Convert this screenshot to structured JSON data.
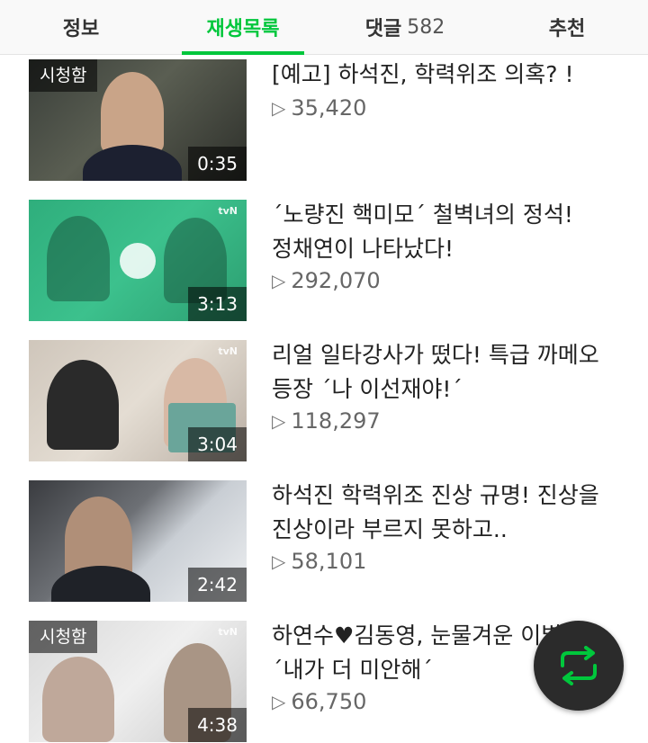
{
  "tabs": [
    {
      "label": "정보"
    },
    {
      "label": "재생목록"
    },
    {
      "label": "댓글",
      "count": "582"
    },
    {
      "label": "추천"
    }
  ],
  "videos": [
    {
      "title_line1": "[예고] 하석진, 학력위조 의혹? !",
      "title_line2": "",
      "views": "35,420",
      "duration": "0:35",
      "badge": "시청함",
      "logo": ""
    },
    {
      "title_line1": "´노량진 핵미모´ 철벽녀의 정석!",
      "title_line2": "정채연이 나타났다!",
      "views": "292,070",
      "duration": "3:13",
      "badge": "",
      "logo": "tvN"
    },
    {
      "title_line1": "리얼 일타강사가 떴다! 특급 까메오",
      "title_line2": "등장 ´나 이선재야!´",
      "views": "118,297",
      "duration": "3:04",
      "badge": "",
      "logo": "tvN"
    },
    {
      "title_line1": "하석진 학력위조 진상 규명! 진상을",
      "title_line2": "진상이라 부르지 못하고..",
      "views": "58,101",
      "duration": "2:42",
      "badge": "",
      "logo": ""
    },
    {
      "title_line1": "하연수♥김동영, 눈물겨운 이별",
      "title_line2": "´내가 더 미안해´",
      "views": "66,750",
      "duration": "4:38",
      "badge": "시청함",
      "logo": "tvN"
    }
  ],
  "icons": {
    "play_triangle": "▷",
    "repeat": "repeat-icon"
  },
  "colors": {
    "accent": "#00c73c",
    "fab_bg": "#2b2b2b"
  }
}
